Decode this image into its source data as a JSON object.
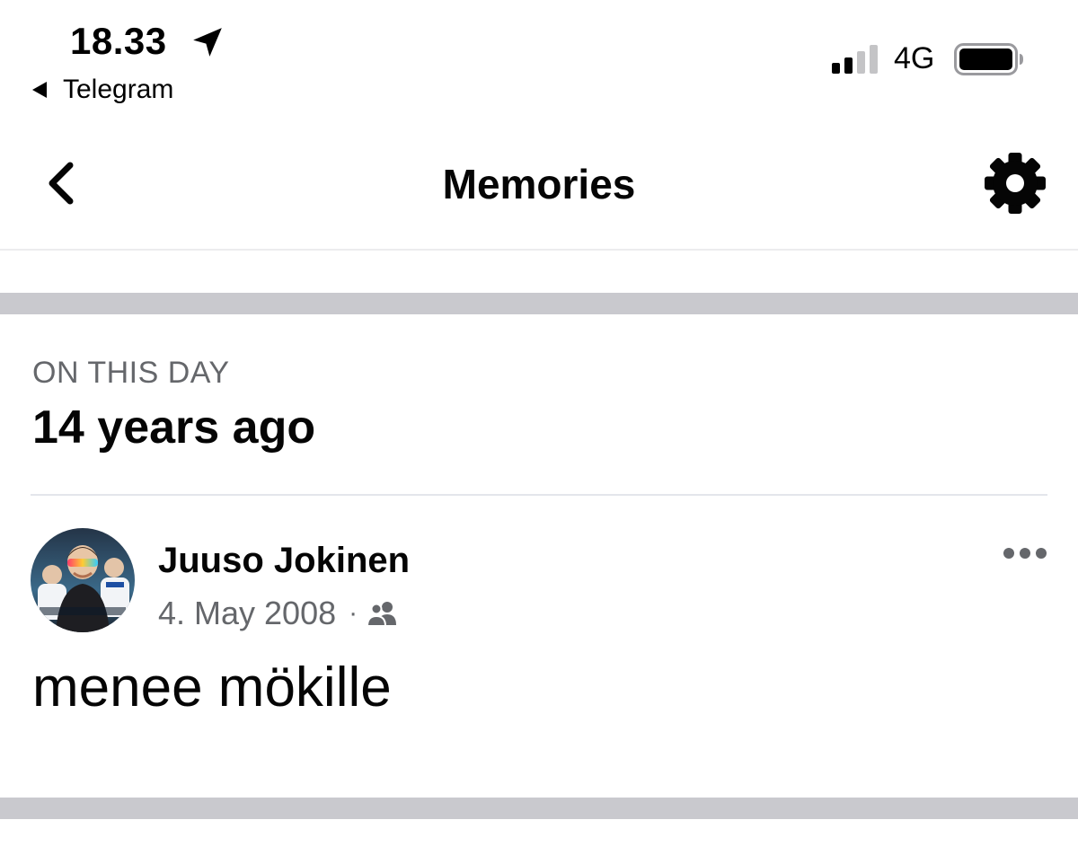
{
  "status_bar": {
    "time": "18.33",
    "back_app": "Telegram",
    "network": "4G",
    "location_icon": "location-arrow-icon",
    "signal_icon": "cellular-signal-icon",
    "battery_icon": "battery-icon"
  },
  "nav": {
    "title": "Memories",
    "back_icon": "chevron-left-icon",
    "settings_icon": "gear-icon"
  },
  "section": {
    "label": "ON THIS DAY",
    "heading": "14 years ago"
  },
  "post": {
    "author": "Juuso Jokinen",
    "date": "4. May 2008",
    "separator": "·",
    "audience_icon": "friends-icon",
    "more_icon": "more-horizontal-icon",
    "text": "menee mökille"
  },
  "colors": {
    "text_primary": "#050505",
    "text_secondary": "#65676b",
    "separator_band": "#c9c9ce",
    "divider": "#e4e6eb"
  }
}
